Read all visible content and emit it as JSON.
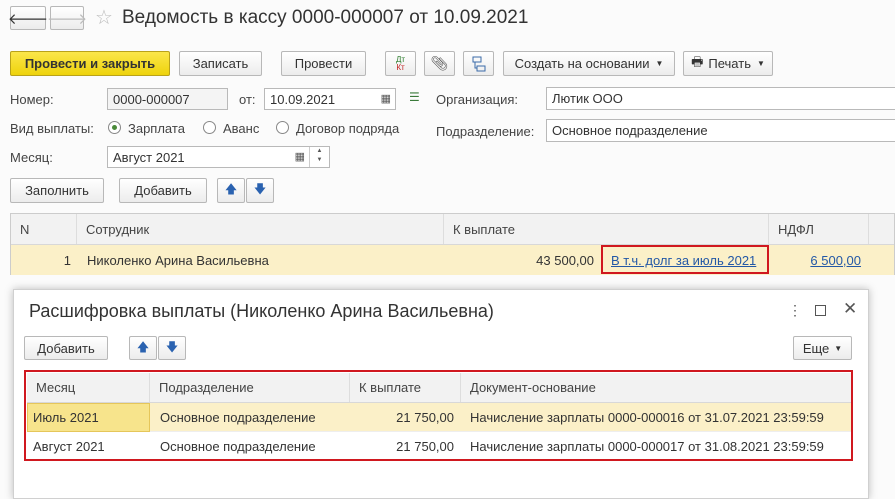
{
  "window": {
    "title": "Ведомость в кассу 0000-000007 от 10.09.2021"
  },
  "toolbar": {
    "post_close": "Провести и закрыть",
    "save": "Записать",
    "post": "Провести",
    "create_based": "Создать на основании",
    "print": "Печать"
  },
  "form": {
    "number_label": "Номер:",
    "number_value": "0000-000007",
    "date_label": "от:",
    "date_value": "10.09.2021",
    "org_label": "Организация:",
    "org_value": "Лютик ООО",
    "pay_type_label": "Вид выплаты:",
    "pay_options": [
      "Зарплата",
      "Аванс",
      "Договор подряда"
    ],
    "pay_selected": "Зарплата",
    "dept_label": "Подразделение:",
    "dept_value": "Основное подразделение",
    "month_label": "Месяц:",
    "month_value": "Август 2021"
  },
  "table_toolbar": {
    "fill": "Заполнить",
    "add": "Добавить"
  },
  "table": {
    "headers": [
      "N",
      "Сотрудник",
      "К выплате",
      "НДФЛ"
    ],
    "rows": [
      {
        "n": "1",
        "employee": "Николенко Арина Васильевна",
        "amount": "43 500,00",
        "debt_link": "В т.ч. долг за июль 2021",
        "ndfl": "6 500,00"
      }
    ]
  },
  "popup": {
    "title": "Расшифровка выплаты (Николенко Арина Васильевна)",
    "add": "Добавить",
    "more": "Еще",
    "headers": [
      "Месяц",
      "Подразделение",
      "К выплате",
      "Документ-основание"
    ],
    "rows": [
      {
        "month": "Июль 2021",
        "dept": "Основное подразделение",
        "amount": "21 750,00",
        "doc": "Начисление зарплаты 0000-000016 от 31.07.2021 23:59:59"
      },
      {
        "month": "Август 2021",
        "dept": "Основное подразделение",
        "amount": "21 750,00",
        "doc": "Начисление зарплаты 0000-000017 от 31.08.2021 23:59:59"
      }
    ]
  },
  "colors": {
    "accent_yellow": "#f0d820",
    "highlight_red": "#d0181f",
    "link": "#2358a6",
    "selected_row": "#fbf0c8"
  }
}
